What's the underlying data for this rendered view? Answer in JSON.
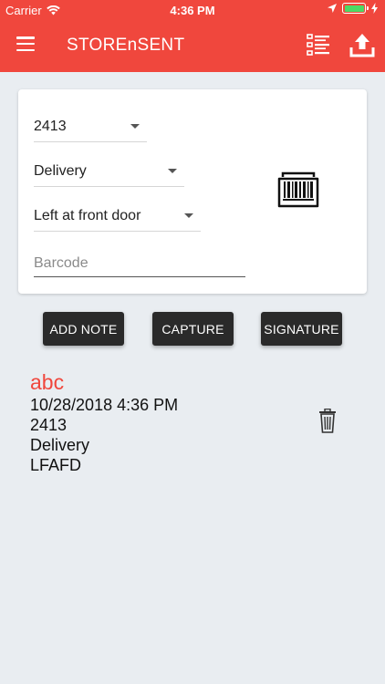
{
  "status_bar": {
    "carrier": "Carrier",
    "time": "4:36 PM"
  },
  "header": {
    "title": "STOREnSENT",
    "menu_icon": "menu-icon",
    "list_icon": "list-icon",
    "upload_icon": "upload-icon"
  },
  "form": {
    "order_select": "2413",
    "type_select": "Delivery",
    "note_select": "Left at front door",
    "barcode_placeholder": "Barcode",
    "barcode_value": "",
    "scan_icon": "barcode-scanner-icon"
  },
  "actions": {
    "add_note": "ADD NOTE",
    "capture": "CAPTURE",
    "signature": "SIGNATURE"
  },
  "entry": {
    "title": "abc",
    "datetime": "10/28/2018 4:36 PM",
    "order": "2413",
    "type": "Delivery",
    "code": "LFAFD",
    "delete_icon": "trash-icon"
  },
  "colors": {
    "brand": "#f0473d",
    "background": "#e9edf1",
    "button": "#2a2a2a"
  }
}
